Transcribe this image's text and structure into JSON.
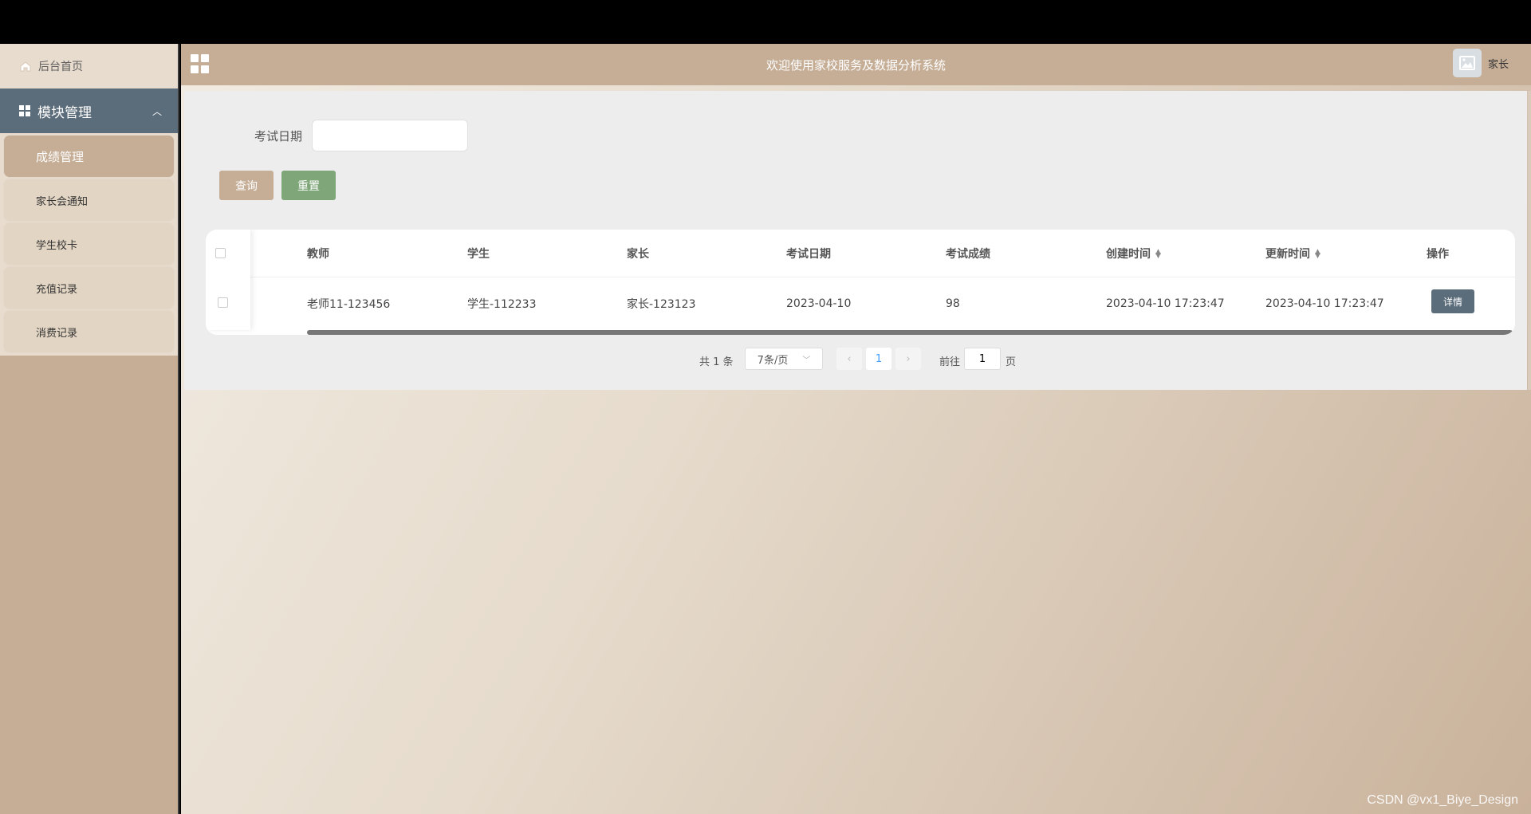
{
  "header": {
    "title": "欢迎使用家校服务及数据分析系统",
    "user_label": "家长"
  },
  "sidebar": {
    "home_label": "后台首页",
    "module_label": "模块管理",
    "items": [
      {
        "label": "成绩管理"
      },
      {
        "label": "家长会通知"
      },
      {
        "label": "学生校卡"
      },
      {
        "label": "充值记录"
      },
      {
        "label": "消费记录"
      }
    ]
  },
  "search": {
    "date_label": "考试日期",
    "date_value": "",
    "query_label": "查询",
    "reset_label": "重置"
  },
  "table": {
    "columns": [
      "教师",
      "学生",
      "家长",
      "考试日期",
      "考试成绩",
      "创建时间",
      "更新时间",
      "操作"
    ],
    "rows": [
      {
        "teacher": "老师11-123456",
        "student": "学生-112233",
        "parent": "家长-123123",
        "exam_date": "2023-04-10",
        "score": "98",
        "created": "2023-04-10 17:23:47",
        "updated": "2023-04-10 17:23:47",
        "action": "详情"
      }
    ]
  },
  "pager": {
    "total": "共 1 条",
    "page_size": "7条/页",
    "current_page": "1",
    "goto_label": "前往",
    "goto_value": "1",
    "page_unit": "页"
  },
  "watermark": "CSDN @vx1_Biye_Design"
}
